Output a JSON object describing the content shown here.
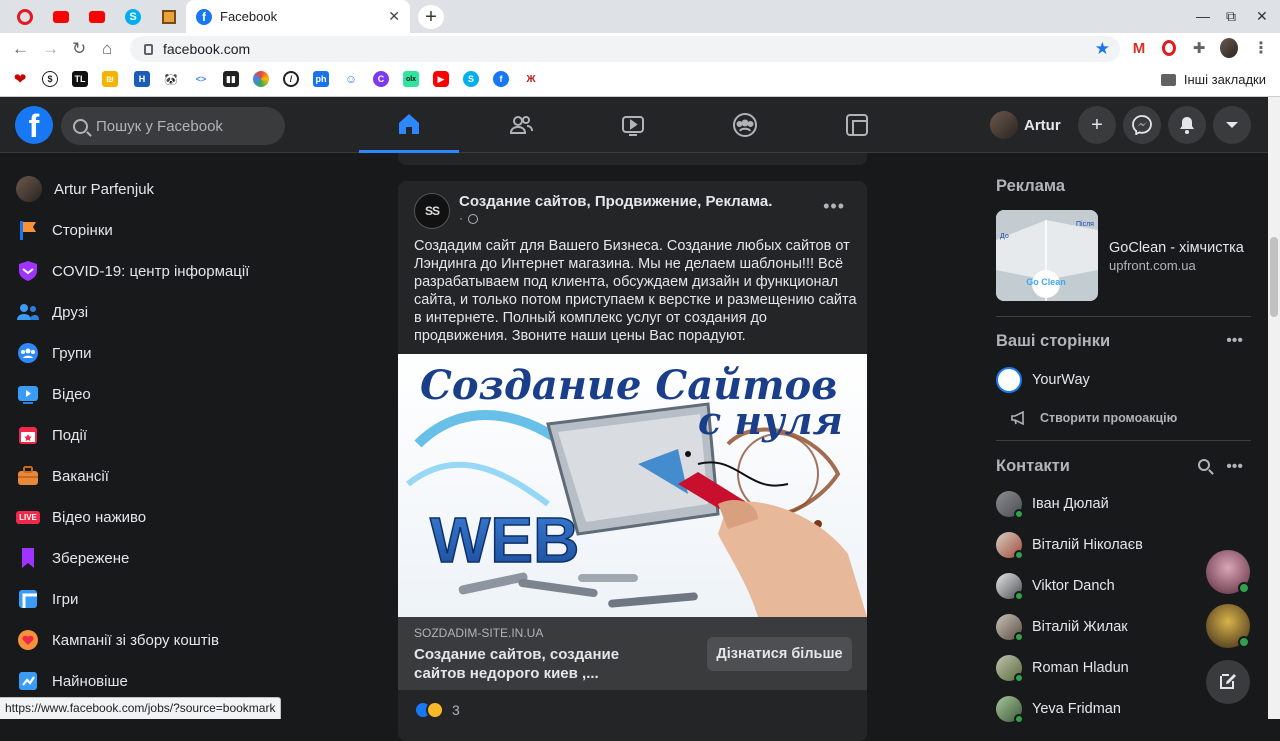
{
  "browser": {
    "tab_title": "Facebook",
    "url": "facebook.com",
    "bookmarks_folder": "Інші закладки",
    "status_url": "https://www.facebook.com/jobs/?source=bookmark"
  },
  "header": {
    "search_placeholder": "Пошук у Facebook",
    "profile_name": "Artur"
  },
  "leftnav": {
    "items": [
      {
        "label": "Artur Parfenjuk",
        "icon": "avatar"
      },
      {
        "label": "Сторінки",
        "icon": "flag-icon"
      },
      {
        "label": "COVID-19: центр інформації",
        "icon": "covid-shield-icon"
      },
      {
        "label": "Друзі",
        "icon": "friends-icon"
      },
      {
        "label": "Групи",
        "icon": "groups-icon"
      },
      {
        "label": "Відео",
        "icon": "video-icon"
      },
      {
        "label": "Події",
        "icon": "calendar-icon"
      },
      {
        "label": "Вакансії",
        "icon": "briefcase-icon"
      },
      {
        "label": "Відео наживо",
        "icon": "live-icon",
        "badge": "LIVE"
      },
      {
        "label": "Збережене",
        "icon": "bookmark-icon"
      },
      {
        "label": "Ігри",
        "icon": "games-icon"
      },
      {
        "label": "Кампанії зі збору коштів",
        "icon": "heart-icon"
      },
      {
        "label": "Найновіше",
        "icon": "recent-icon"
      }
    ]
  },
  "post": {
    "page_logo_text": "SS",
    "page_name": "Создание сайтов, Продвижение, Реклама.",
    "meta": "·",
    "text": "Создадим сайт для Вашего Бизнеса. Создание любых сайтов от Лэндинга до Интернет  магазина. Мы не делаем шаблоны!!! Всё разрабатываем под клиента, обсуждаем дизайн и функционал сайта, и только потом приступаем к верстке и размещению сайта в интернете. Полный комплекс услуг от создания до продвижения. Звоните наши цены Вас порадуют.",
    "image_title_line1": "Создание Сайтов",
    "image_title_line2": "с нуля",
    "image_word": "WEB",
    "link_domain": "SOZDADIM-SITE.IN.UA",
    "link_title": "Создание сайтов, создание сайтов недорого киев ,...",
    "cta": "Дізнатися більше",
    "reaction_count": "3"
  },
  "right": {
    "ads_heading": "Реклама",
    "ad": {
      "title": "GoClean - хімчистка",
      "url": "upfront.com.ua",
      "img_label_left": "До",
      "img_label_right": "Після",
      "img_logo": "Go Clean"
    },
    "pages_heading": "Ваші сторінки",
    "page_name": "YourWay",
    "promo_label": "Створити промоакцію",
    "contacts_heading": "Контакти",
    "contacts": [
      "Іван Дюлай",
      "Віталій Ніколаєв",
      "Viktor Danch",
      "Віталій Жилак",
      "Roman Hladun",
      "Yeva Fridman"
    ]
  },
  "colors": {
    "fb_blue": "#1877f2",
    "bg": "#18191a",
    "card": "#242526",
    "online": "#31a24c"
  }
}
